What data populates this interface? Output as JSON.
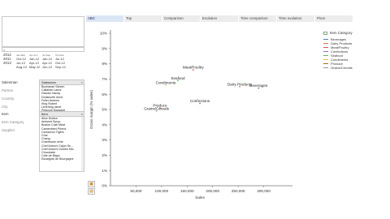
{
  "search": {
    "icon": "search-icon"
  },
  "calendar": {
    "years": [
      "2012",
      "2011",
      "2013"
    ],
    "month_headers": [
      "Jan-Mar",
      "Apr-Jun",
      "Jul-Sep",
      "Oct-Dec"
    ],
    "rows": [
      [
        "Oct-12",
        "Jan-12",
        "Jan-12",
        "Jul-12"
      ],
      [
        "Jul-13",
        "Apr-12",
        "Apr-12",
        "Oct-12"
      ],
      [
        "Aug-13",
        "May-12",
        "Jun-12",
        "Sep-12"
      ]
    ]
  },
  "salesman": {
    "filters": [
      "Salesman",
      "Partner",
      "Country",
      "City"
    ],
    "list_title": "Salesman",
    "items": [
      "Buchanan Steven",
      "Callahan Laura",
      "Davolio Nancy",
      "Dodsworth Anne",
      "Fuller Andrew",
      "King Robert",
      "Leverling Janet",
      "Peacock Margaret",
      "Suyama Michael"
    ]
  },
  "item": {
    "filters": [
      "Item",
      "Item Category",
      "Supplier"
    ],
    "list_title": "Item",
    "items": [
      "Alice Mutton",
      "Aniseed Syrup",
      "Boston Crab Meat",
      "Camembert Pierrot",
      "Carnarvon Tigers",
      "Chai",
      "Chang",
      "Chartreuse verte",
      "Chef Anton's Cajun Se...",
      "Chef Anton's Gumbo Mix",
      "Chocolade",
      "Côte de Blaye",
      "Escargots de Bourgogne"
    ]
  },
  "tabs": [
    "ABC",
    "Top",
    "Comparison",
    "Evolution",
    "Time comparison",
    "Time evolution",
    "Pivot"
  ],
  "active_tab": "ABC",
  "legend": {
    "title": "Item Category",
    "items": [
      {
        "label": "Beverages",
        "color": "#4f7fbf"
      },
      {
        "label": "Dairy Products",
        "color": "#e07b39"
      },
      {
        "label": "Meat/Poultry",
        "color": "#d9534f"
      },
      {
        "label": "Confections",
        "color": "#8e6bbf"
      },
      {
        "label": "Seafood",
        "color": "#5cb85c"
      },
      {
        "label": "Condiments",
        "color": "#e6c229"
      },
      {
        "label": "Produce",
        "color": "#b5651d"
      },
      {
        "label": "Grains/Cereals",
        "color": "#999999"
      }
    ]
  },
  "chart_data": {
    "type": "scatter",
    "xlabel": "Sales",
    "ylabel": "Gross margin (% sales)",
    "xlim": [
      0,
      350000
    ],
    "ylim": [
      0,
      10
    ],
    "x_ticks": [
      "50,000",
      "100,000",
      "150,000",
      "200,000",
      "250,000",
      "300,000"
    ],
    "y_ticks": [
      "0%",
      "1%",
      "2%",
      "3%",
      "4%",
      "5%",
      "6%",
      "7%",
      "8%",
      "9%",
      "10%"
    ],
    "points": [
      {
        "label": "Meat/Poultry",
        "x": 162000,
        "y": 7.6
      },
      {
        "label": "Seafood",
        "x": 132000,
        "y": 6.9
      },
      {
        "label": "Condiments",
        "x": 108000,
        "y": 6.6
      },
      {
        "label": "Dairy Products",
        "x": 253000,
        "y": 6.5
      },
      {
        "label": "Beverages",
        "x": 290000,
        "y": 6.4
      },
      {
        "label": "Confections",
        "x": 175000,
        "y": 5.4
      },
      {
        "label": "Produce",
        "x": 97000,
        "y": 5.1
      },
      {
        "label": "Grains/Cereals",
        "x": 90000,
        "y": 4.9
      }
    ]
  }
}
